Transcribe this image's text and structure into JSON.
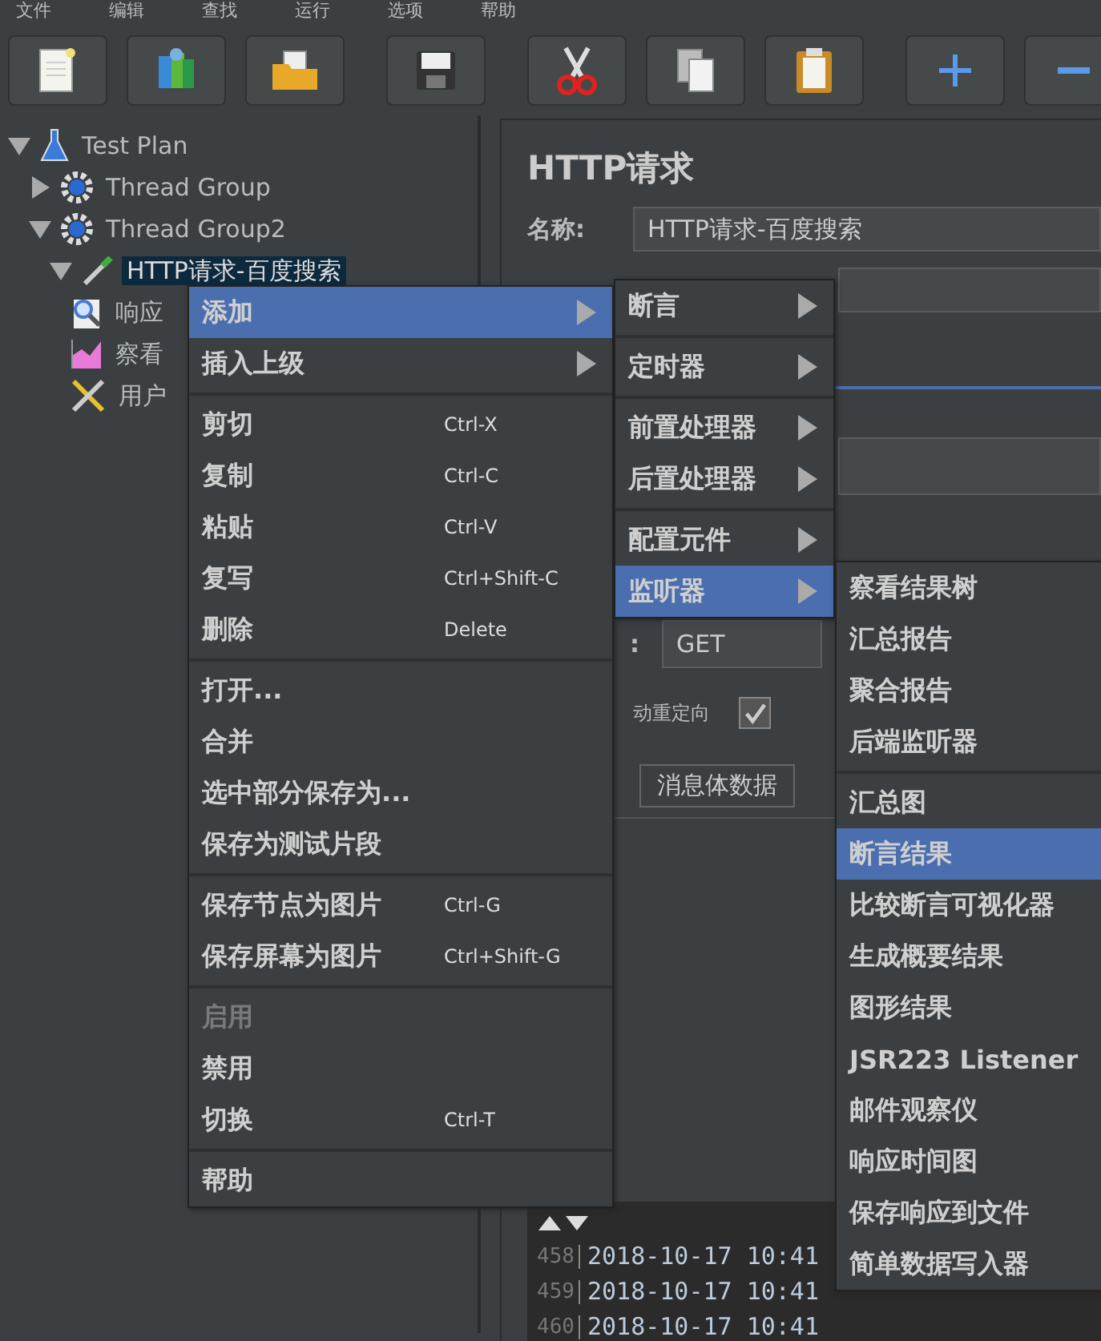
{
  "menu_bar": [
    "文件",
    "编辑",
    "查找",
    "运行",
    "选项",
    "帮助"
  ],
  "toolbar": [
    {
      "kind": "new"
    },
    {
      "kind": "templates"
    },
    {
      "kind": "open"
    },
    {
      "kind": "save"
    },
    {
      "kind": "cut"
    },
    {
      "kind": "copy"
    },
    {
      "kind": "paste"
    },
    {
      "kind": "add"
    },
    {
      "kind": "remove"
    }
  ],
  "tree": [
    {
      "label": "Test Plan",
      "kind": "plan",
      "expanded": true,
      "selected": false,
      "children": [
        {
          "label": "Thread Group",
          "kind": "group",
          "expanded": false,
          "selected": false
        },
        {
          "label": "Thread Group2",
          "kind": "group",
          "expanded": true,
          "selected": false,
          "children": [
            {
              "label": "HTTP请求-百度搜索",
              "kind": "sampler",
              "expanded": true,
              "selected": true,
              "children": [
                {
                  "label": "响应",
                  "kind": "assertion",
                  "selected": false
                },
                {
                  "label": "察看",
                  "kind": "listener",
                  "selected": false
                },
                {
                  "label": "用户",
                  "kind": "config",
                  "selected": false
                }
              ]
            }
          ]
        }
      ]
    }
  ],
  "editor": {
    "title": "HTTP请求",
    "name_label": "名称:",
    "name_value": "HTTP请求-百度搜索",
    "method_label": ":",
    "method_value": "GET",
    "redirect_label": "动重定向",
    "redirect_checked": true,
    "tab": "消息体数据"
  },
  "log": [
    {
      "line": "458",
      "text": "2018-10-17 10:41"
    },
    {
      "line": "459",
      "text": "2018-10-17 10:41"
    },
    {
      "line": "460",
      "text": "2018-10-17 10:41"
    }
  ],
  "context_menu": [
    [
      {
        "label": "添加",
        "submenu": true,
        "selected": true,
        "disabled": false
      },
      {
        "label": "插入上级",
        "submenu": true,
        "selected": false,
        "disabled": false
      }
    ],
    [
      {
        "label": "剪切",
        "shortcut": "Ctrl-X",
        "submenu": false,
        "selected": false,
        "disabled": false
      },
      {
        "label": "复制",
        "shortcut": "Ctrl-C",
        "submenu": false,
        "selected": false,
        "disabled": false
      },
      {
        "label": "粘贴",
        "shortcut": "Ctrl-V",
        "submenu": false,
        "selected": false,
        "disabled": false
      },
      {
        "label": "复写",
        "shortcut": "Ctrl+Shift-C",
        "submenu": false,
        "selected": false,
        "disabled": false
      },
      {
        "label": "删除",
        "shortcut": "Delete",
        "submenu": false,
        "selected": false,
        "disabled": false
      }
    ],
    [
      {
        "label": "打开...",
        "submenu": false,
        "selected": false,
        "disabled": false
      },
      {
        "label": "合并",
        "submenu": false,
        "selected": false,
        "disabled": false
      },
      {
        "label": "选中部分保存为...",
        "submenu": false,
        "selected": false,
        "disabled": false
      },
      {
        "label": "保存为测试片段",
        "submenu": false,
        "selected": false,
        "disabled": false
      }
    ],
    [
      {
        "label": "保存节点为图片",
        "shortcut": "Ctrl-G",
        "submenu": false,
        "selected": false,
        "disabled": false
      },
      {
        "label": "保存屏幕为图片",
        "shortcut": "Ctrl+Shift-G",
        "submenu": false,
        "selected": false,
        "disabled": false
      }
    ],
    [
      {
        "label": "启用",
        "submenu": false,
        "selected": false,
        "disabled": true
      },
      {
        "label": "禁用",
        "submenu": false,
        "selected": false,
        "disabled": false
      },
      {
        "label": "切换",
        "shortcut": "Ctrl-T",
        "submenu": false,
        "selected": false,
        "disabled": false
      }
    ],
    [
      {
        "label": "帮助",
        "submenu": false,
        "selected": false,
        "disabled": false
      }
    ]
  ],
  "add_submenu": [
    [
      {
        "label": "断言",
        "submenu": true,
        "selected": false
      }
    ],
    [
      {
        "label": "定时器",
        "submenu": true,
        "selected": false
      }
    ],
    [
      {
        "label": "前置处理器",
        "submenu": true,
        "selected": false
      },
      {
        "label": "后置处理器",
        "submenu": true,
        "selected": false
      }
    ],
    [
      {
        "label": "配置元件",
        "submenu": true,
        "selected": false
      },
      {
        "label": "监听器",
        "submenu": true,
        "selected": true
      }
    ]
  ],
  "listener_submenu": [
    [
      {
        "label": "察看结果树",
        "selected": false
      },
      {
        "label": "汇总报告",
        "selected": false
      },
      {
        "label": "聚合报告",
        "selected": false
      },
      {
        "label": "后端监听器",
        "selected": false
      }
    ],
    [
      {
        "label": "汇总图",
        "selected": false
      },
      {
        "label": "断言结果",
        "selected": true
      },
      {
        "label": "比较断言可视化器",
        "selected": false
      },
      {
        "label": "生成概要结果",
        "selected": false
      },
      {
        "label": "图形结果",
        "selected": false
      },
      {
        "label": "JSR223 Listener",
        "selected": false
      },
      {
        "label": "邮件观察仪",
        "selected": false
      },
      {
        "label": "响应时间图",
        "selected": false
      },
      {
        "label": "保存响应到文件",
        "selected": false
      },
      {
        "label": "简单数据写入器",
        "selected": false
      }
    ]
  ]
}
